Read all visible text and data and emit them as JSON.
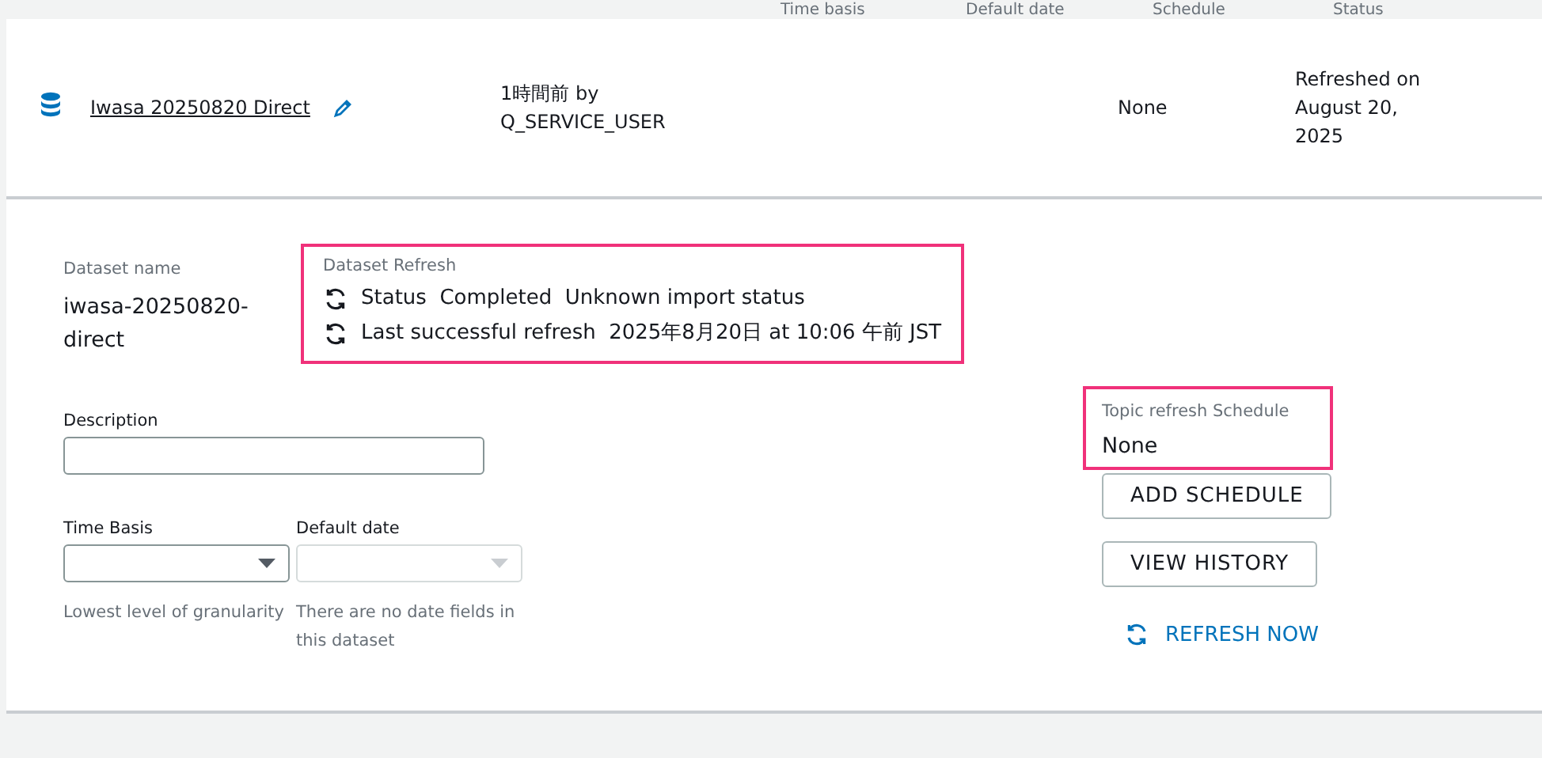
{
  "table": {
    "columns": [
      "Time basis",
      "Default date",
      "Schedule",
      "Status"
    ],
    "rows": [
      {
        "name": "Iwasa 20250820 Direct",
        "updated": "1時間前 by",
        "updated_by": "Q_SERVICE_USER",
        "schedule": "None",
        "status": "Refreshed on August 20, 2025",
        "expanded": true
      }
    ]
  },
  "details": {
    "dataset_name": {
      "label": "Dataset name",
      "value": "iwasa-20250820-direct"
    },
    "dataset_refresh": {
      "label": "Dataset Refresh",
      "highlighted": true,
      "lines": [
        {
          "label": "Status",
          "value": "Completed",
          "note": "Unknown import status"
        },
        {
          "label": "Last successful refresh",
          "value": "2025年8月20日 at 10:06 午前 JST"
        }
      ]
    },
    "description": {
      "label": "Description"
    },
    "time_basis": {
      "label": "Time Basis",
      "disabled": false,
      "help": "Lowest level of granularity"
    },
    "default_date": {
      "label": "Default date",
      "disabled": true,
      "help": "There are no date fields in this dataset"
    },
    "topic_schedule": {
      "label": "Topic refresh Schedule",
      "value": "None",
      "highlighted": true
    },
    "buttons": [
      "ADD SCHEDULE",
      "VIEW HISTORY"
    ],
    "refresh_link": "REFRESH NOW"
  }
}
